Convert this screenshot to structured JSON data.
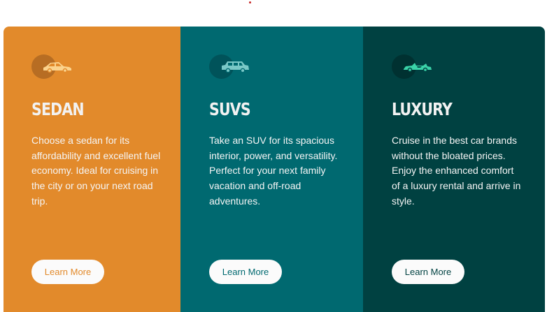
{
  "cards": [
    {
      "title": "SEDAN",
      "description": "Choose a sedan for its affordability and excellent fuel economy. Ideal for cruising in the city or on your next road trip.",
      "button_label": "Learn More",
      "icon": "sedan-car-icon",
      "color": "#e28a2b"
    },
    {
      "title": "SUVS",
      "description": "Take an SUV for its spacious interior, power, and versatility. Perfect for your next family vacation and off-road adventures.",
      "button_label": "Learn More",
      "icon": "suv-car-icon",
      "color": "#006970"
    },
    {
      "title": "LUXURY",
      "description": "Cruise in the best car brands without the bloated prices. Enjoy the enhanced comfort of a luxury rental and arrive in style.",
      "button_label": "Learn More",
      "icon": "luxury-car-icon",
      "color": "#004141"
    }
  ],
  "colors": {
    "icon_sedan": "#fbd38d",
    "icon_suv": "#79c8c7",
    "icon_luxury": "#3ad3a8",
    "text": "#f2f2f2",
    "button_bg": "#fbfbfb"
  }
}
